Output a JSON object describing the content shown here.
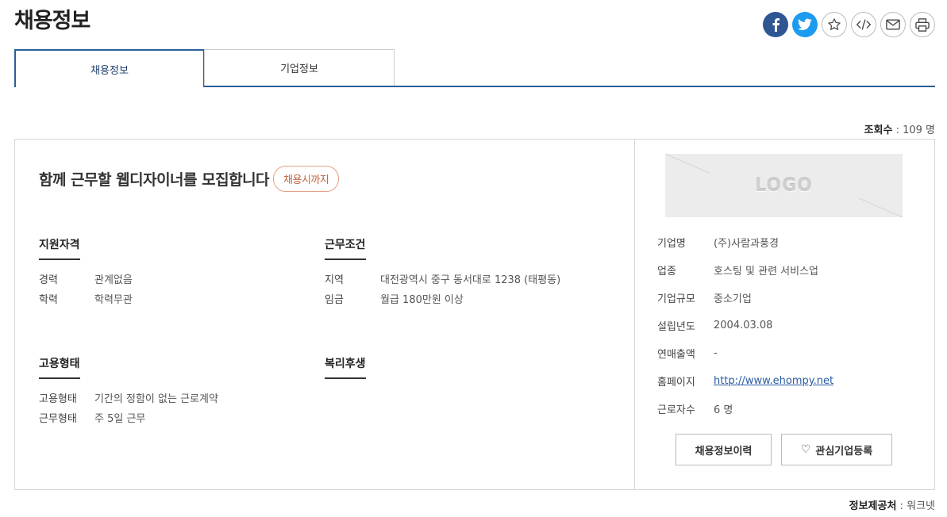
{
  "page": {
    "title": "채용정보"
  },
  "share": {
    "icons": [
      "facebook-icon",
      "twitter-icon",
      "star-icon",
      "embed-code-icon",
      "mail-icon",
      "print-icon"
    ],
    "colors": {
      "facebook": "#2f5693",
      "twitter": "#1d9bf0"
    }
  },
  "tabs": [
    {
      "label": "채용정보",
      "active": true
    },
    {
      "label": "기업정보",
      "active": false
    }
  ],
  "views": {
    "label": "조회수",
    "value": "109 명"
  },
  "job": {
    "title": "함께 근무할 웹디자이너를 모집합니다",
    "deadline_badge": "채용시까지"
  },
  "sections": {
    "qualification": {
      "title": "지원자격",
      "rows": [
        {
          "key": "경력",
          "value": "관계없음"
        },
        {
          "key": "학력",
          "value": "학력무관"
        }
      ]
    },
    "conditions": {
      "title": "근무조건",
      "rows": [
        {
          "key": "지역",
          "value": "대전광역시 중구 동서대로 1238 (태평동)"
        },
        {
          "key": "임금",
          "value": "월급 180만원 이상"
        }
      ]
    },
    "employment": {
      "title": "고용형태",
      "rows": [
        {
          "key": "고용형태",
          "value": "기간의 정함이 없는 근로계약"
        },
        {
          "key": "근무형태",
          "value": "주 5일 근무"
        }
      ]
    },
    "welfare": {
      "title": "복리후생"
    }
  },
  "company": {
    "logo_text": "LOGO",
    "rows": [
      {
        "key": "기업명",
        "value": "(주)사람과풍경"
      },
      {
        "key": "업종",
        "value": "호스팅 및 관련 서비스업"
      },
      {
        "key": "기업규모",
        "value": "중소기업"
      },
      {
        "key": "설립년도",
        "value": "2004.03.08"
      },
      {
        "key": "연매출액",
        "value": "-"
      },
      {
        "key": "홈페이지",
        "value": "http://www.ehompy.net"
      },
      {
        "key": "근로자수",
        "value": "6 명"
      }
    ],
    "buttons": {
      "history": "채용정보이력",
      "favorite": "관심기업등록"
    }
  },
  "provider": {
    "label": "정보제공처",
    "value": "워크넷"
  }
}
